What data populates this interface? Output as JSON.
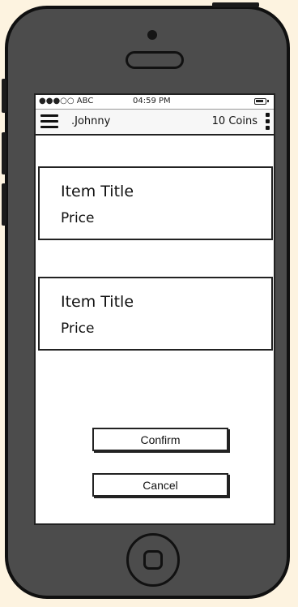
{
  "status_bar": {
    "carrier": "●●●○○ ABC",
    "time": "04:59 PM",
    "battery_icon": "battery-icon"
  },
  "nav": {
    "menu_icon": "menu-icon",
    "user_name": ".Johnny",
    "coins": "10 Coins",
    "more_icon": "more-vertical-icon"
  },
  "items": [
    {
      "title": "Item Title",
      "price": "Price"
    },
    {
      "title": "Item Title",
      "price": "Price"
    }
  ],
  "actions": {
    "confirm_label": "Confirm",
    "cancel_label": "Cancel"
  },
  "device": {
    "home_button_icon": "home-button-icon"
  }
}
